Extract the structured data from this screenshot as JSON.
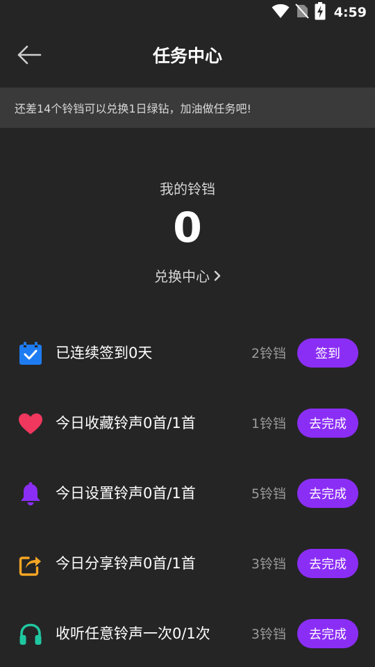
{
  "status_bar": {
    "time": "4:59"
  },
  "header": {
    "title": "任务中心"
  },
  "notice": {
    "text": "还差14个铃铛可以兑换1日绿钻，加油做任务吧!"
  },
  "balance": {
    "label": "我的铃铛",
    "value": "0",
    "exchange_label": "兑换中心"
  },
  "tasks": [
    {
      "label": "已连续签到0天",
      "reward": "2铃铛",
      "button": "签到",
      "icon": "calendar-check-icon",
      "color": "#1e7cf2"
    },
    {
      "label": "今日收藏铃声0首/1首",
      "reward": "1铃铛",
      "button": "去完成",
      "icon": "heart-icon",
      "color": "#f0375d"
    },
    {
      "label": "今日设置铃声0首/1首",
      "reward": "5铃铛",
      "button": "去完成",
      "icon": "bell-icon",
      "color": "#8b2ef5"
    },
    {
      "label": "今日分享铃声0首/1首",
      "reward": "3铃铛",
      "button": "去完成",
      "icon": "share-icon",
      "color": "#f5a623"
    },
    {
      "label": "收听任意铃声一次0/1次",
      "reward": "3铃铛",
      "button": "去完成",
      "icon": "headphones-icon",
      "color": "#1fc7a0"
    }
  ],
  "colors": {
    "accent": "#8b2ef5",
    "background": "#252526",
    "banner": "#3a3a3b"
  }
}
